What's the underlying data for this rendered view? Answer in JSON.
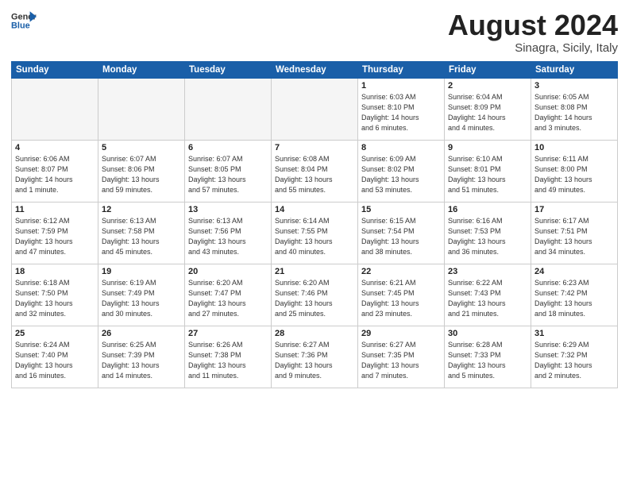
{
  "logo": {
    "line1": "General",
    "line2": "Blue"
  },
  "title": "August 2024",
  "subtitle": "Sinagra, Sicily, Italy",
  "days_of_week": [
    "Sunday",
    "Monday",
    "Tuesday",
    "Wednesday",
    "Thursday",
    "Friday",
    "Saturday"
  ],
  "weeks": [
    [
      {
        "num": "",
        "info": ""
      },
      {
        "num": "",
        "info": ""
      },
      {
        "num": "",
        "info": ""
      },
      {
        "num": "",
        "info": ""
      },
      {
        "num": "1",
        "info": "Sunrise: 6:03 AM\nSunset: 8:10 PM\nDaylight: 14 hours\nand 6 minutes."
      },
      {
        "num": "2",
        "info": "Sunrise: 6:04 AM\nSunset: 8:09 PM\nDaylight: 14 hours\nand 4 minutes."
      },
      {
        "num": "3",
        "info": "Sunrise: 6:05 AM\nSunset: 8:08 PM\nDaylight: 14 hours\nand 3 minutes."
      }
    ],
    [
      {
        "num": "4",
        "info": "Sunrise: 6:06 AM\nSunset: 8:07 PM\nDaylight: 14 hours\nand 1 minute."
      },
      {
        "num": "5",
        "info": "Sunrise: 6:07 AM\nSunset: 8:06 PM\nDaylight: 13 hours\nand 59 minutes."
      },
      {
        "num": "6",
        "info": "Sunrise: 6:07 AM\nSunset: 8:05 PM\nDaylight: 13 hours\nand 57 minutes."
      },
      {
        "num": "7",
        "info": "Sunrise: 6:08 AM\nSunset: 8:04 PM\nDaylight: 13 hours\nand 55 minutes."
      },
      {
        "num": "8",
        "info": "Sunrise: 6:09 AM\nSunset: 8:02 PM\nDaylight: 13 hours\nand 53 minutes."
      },
      {
        "num": "9",
        "info": "Sunrise: 6:10 AM\nSunset: 8:01 PM\nDaylight: 13 hours\nand 51 minutes."
      },
      {
        "num": "10",
        "info": "Sunrise: 6:11 AM\nSunset: 8:00 PM\nDaylight: 13 hours\nand 49 minutes."
      }
    ],
    [
      {
        "num": "11",
        "info": "Sunrise: 6:12 AM\nSunset: 7:59 PM\nDaylight: 13 hours\nand 47 minutes."
      },
      {
        "num": "12",
        "info": "Sunrise: 6:13 AM\nSunset: 7:58 PM\nDaylight: 13 hours\nand 45 minutes."
      },
      {
        "num": "13",
        "info": "Sunrise: 6:13 AM\nSunset: 7:56 PM\nDaylight: 13 hours\nand 43 minutes."
      },
      {
        "num": "14",
        "info": "Sunrise: 6:14 AM\nSunset: 7:55 PM\nDaylight: 13 hours\nand 40 minutes."
      },
      {
        "num": "15",
        "info": "Sunrise: 6:15 AM\nSunset: 7:54 PM\nDaylight: 13 hours\nand 38 minutes."
      },
      {
        "num": "16",
        "info": "Sunrise: 6:16 AM\nSunset: 7:53 PM\nDaylight: 13 hours\nand 36 minutes."
      },
      {
        "num": "17",
        "info": "Sunrise: 6:17 AM\nSunset: 7:51 PM\nDaylight: 13 hours\nand 34 minutes."
      }
    ],
    [
      {
        "num": "18",
        "info": "Sunrise: 6:18 AM\nSunset: 7:50 PM\nDaylight: 13 hours\nand 32 minutes."
      },
      {
        "num": "19",
        "info": "Sunrise: 6:19 AM\nSunset: 7:49 PM\nDaylight: 13 hours\nand 30 minutes."
      },
      {
        "num": "20",
        "info": "Sunrise: 6:20 AM\nSunset: 7:47 PM\nDaylight: 13 hours\nand 27 minutes."
      },
      {
        "num": "21",
        "info": "Sunrise: 6:20 AM\nSunset: 7:46 PM\nDaylight: 13 hours\nand 25 minutes."
      },
      {
        "num": "22",
        "info": "Sunrise: 6:21 AM\nSunset: 7:45 PM\nDaylight: 13 hours\nand 23 minutes."
      },
      {
        "num": "23",
        "info": "Sunrise: 6:22 AM\nSunset: 7:43 PM\nDaylight: 13 hours\nand 21 minutes."
      },
      {
        "num": "24",
        "info": "Sunrise: 6:23 AM\nSunset: 7:42 PM\nDaylight: 13 hours\nand 18 minutes."
      }
    ],
    [
      {
        "num": "25",
        "info": "Sunrise: 6:24 AM\nSunset: 7:40 PM\nDaylight: 13 hours\nand 16 minutes."
      },
      {
        "num": "26",
        "info": "Sunrise: 6:25 AM\nSunset: 7:39 PM\nDaylight: 13 hours\nand 14 minutes."
      },
      {
        "num": "27",
        "info": "Sunrise: 6:26 AM\nSunset: 7:38 PM\nDaylight: 13 hours\nand 11 minutes."
      },
      {
        "num": "28",
        "info": "Sunrise: 6:27 AM\nSunset: 7:36 PM\nDaylight: 13 hours\nand 9 minutes."
      },
      {
        "num": "29",
        "info": "Sunrise: 6:27 AM\nSunset: 7:35 PM\nDaylight: 13 hours\nand 7 minutes."
      },
      {
        "num": "30",
        "info": "Sunrise: 6:28 AM\nSunset: 7:33 PM\nDaylight: 13 hours\nand 5 minutes."
      },
      {
        "num": "31",
        "info": "Sunrise: 6:29 AM\nSunset: 7:32 PM\nDaylight: 13 hours\nand 2 minutes."
      }
    ]
  ]
}
